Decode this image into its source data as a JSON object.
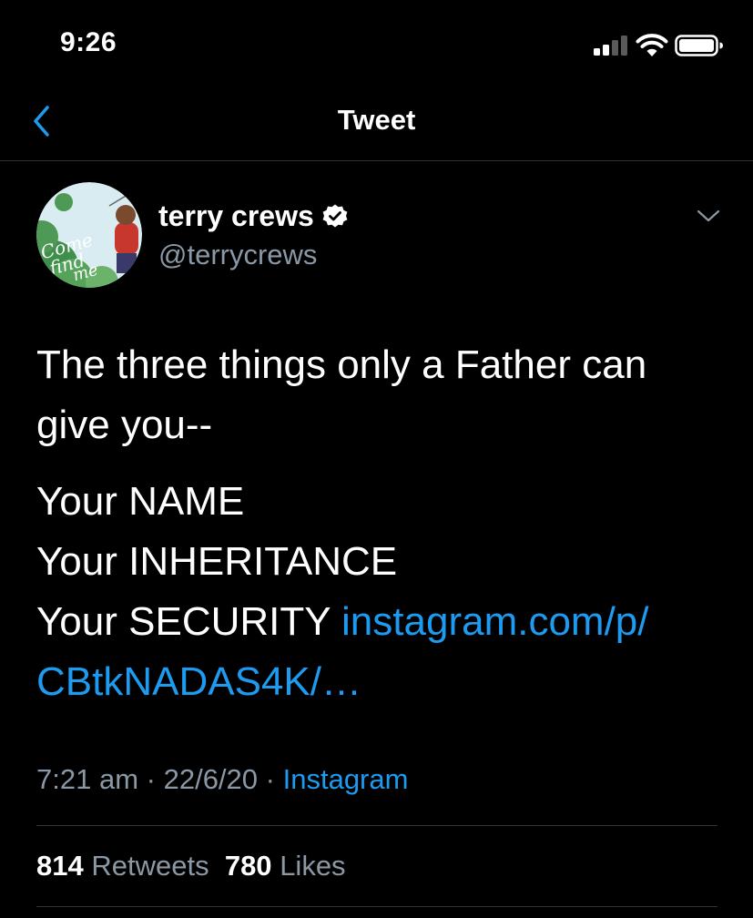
{
  "status_bar": {
    "time": "9:26"
  },
  "nav": {
    "back_icon": "chevron-left-icon",
    "title": "Tweet"
  },
  "tweet": {
    "author": {
      "name": "terry crews",
      "handle": "@terrycrews",
      "verified": true
    },
    "text_lines": [
      "The three things only a Father can give you--",
      "Your NAME",
      "Your INHERITANCE",
      "Your SECURITY "
    ],
    "link_text_1": "instagram.com/p/",
    "link_text_2": "CBtkNADAS4K/…",
    "time": "7:21 am",
    "date": "22/6/20",
    "separator": "·",
    "source": "Instagram",
    "retweets_count": "814",
    "retweets_label": "Retweets",
    "likes_count": "780",
    "likes_label": "Likes"
  },
  "avatar": {
    "logo_text_1": "Come",
    "logo_text_2": "find",
    "logo_text_3": "me"
  },
  "colors": {
    "background": "#000000",
    "text": "#ffffff",
    "secondary": "#8b98a5",
    "accent": "#1d9bf0",
    "divider": "#2f3336"
  }
}
